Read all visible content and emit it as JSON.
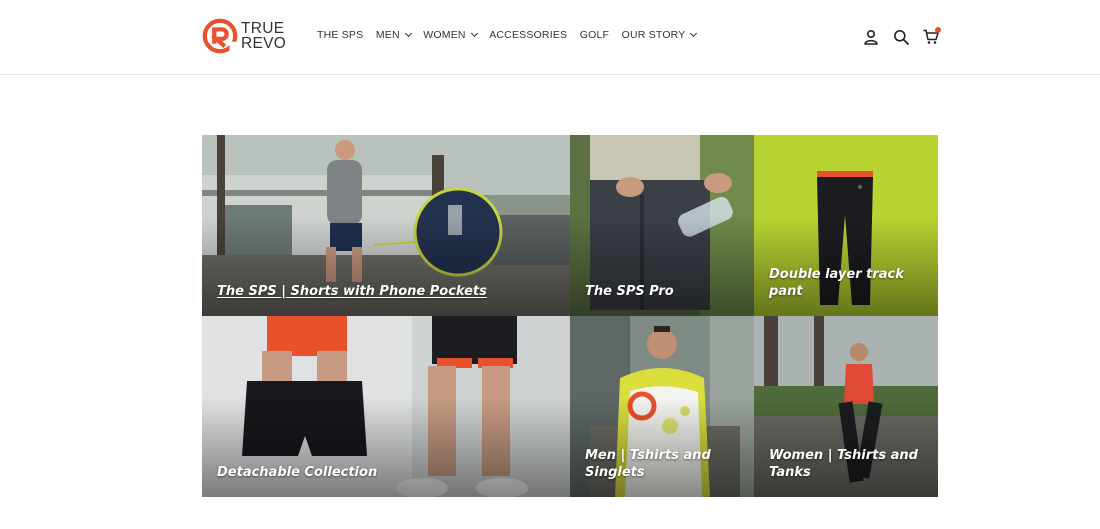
{
  "brand": {
    "line1": "TRUE",
    "line2": "REVO",
    "accent": "#e8512c"
  },
  "nav": {
    "items": [
      {
        "label": "THE SPS",
        "dropdown": false
      },
      {
        "label": "MEN",
        "dropdown": true
      },
      {
        "label": "WOMEN",
        "dropdown": true
      },
      {
        "label": "ACCESSORIES",
        "dropdown": false
      },
      {
        "label": "GOLF",
        "dropdown": false
      },
      {
        "label": "OUR STORY",
        "dropdown": true
      }
    ]
  },
  "header_icons": [
    "account-icon",
    "search-icon",
    "cart-icon"
  ],
  "collections": [
    {
      "title": "The SPS | Shorts with Phone Pockets",
      "underlined": true
    },
    {
      "title": "The SPS Pro"
    },
    {
      "title": "Double layer track pant"
    },
    {
      "title": "Detachable Collection"
    },
    {
      "title": "Men | Tshirts and Singlets"
    },
    {
      "title": "Women | Tshirts and Tanks"
    }
  ]
}
